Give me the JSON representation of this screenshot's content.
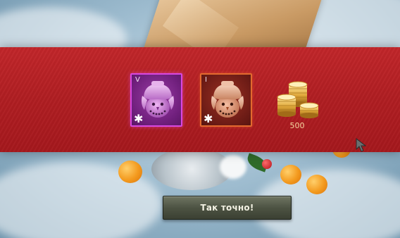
{
  "rewards": [
    {
      "tier": "V",
      "item": "snowman-decoration",
      "rarity_color": "#d848e0"
    },
    {
      "tier": "I",
      "item": "snowman-decoration",
      "rarity_color": "#e26a2e"
    }
  ],
  "gold": {
    "amount": "500",
    "icon": "gold-coins-icon"
  },
  "dialog": {
    "confirm_label": "Так точно!"
  },
  "colors": {
    "banner": "#b01e22",
    "gold_text": "#f6d7a0",
    "button": "#4d5343"
  }
}
